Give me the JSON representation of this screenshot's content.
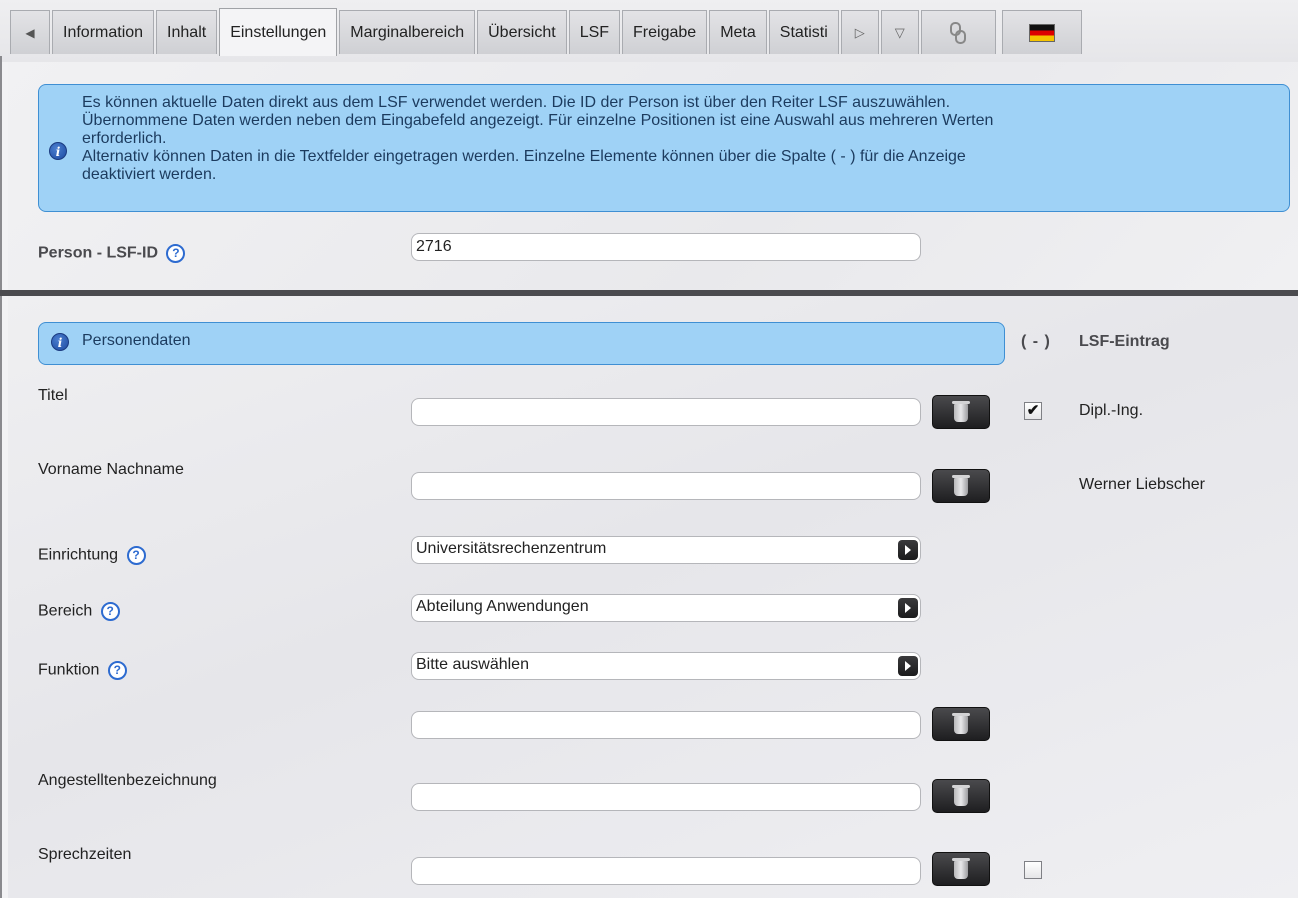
{
  "tabs": {
    "prev_icon": "◀",
    "items": [
      "Information",
      "Inhalt",
      "Einstellungen",
      "Marginalbereich",
      "Übersicht",
      "LSF",
      "Freigabe",
      "Meta",
      "Statisti"
    ],
    "active": "Einstellungen",
    "next_icon": "▷",
    "dropdown_icon": "▽",
    "link_icon": "chain-link-icon",
    "language_flag": "german-flag-icon"
  },
  "info": {
    "line1": "Es können aktuelle Daten direkt aus dem LSF verwendet werden. Die ID der Person ist über den Reiter LSF auszuwählen.",
    "line2": "Übernommene Daten werden neben dem Eingabefeld angezeigt. Für einzelne Positionen ist eine Auswahl aus mehreren Werten",
    "line3": "erforderlich.",
    "line4": "Alternativ können Daten in die Textfelder eingetragen werden. Einzelne Elemente können über die Spalte ( - ) für die Anzeige",
    "line5": "deaktiviert werden."
  },
  "lsf_id": {
    "label": "Person - LSF-ID",
    "value": "2716"
  },
  "section": {
    "title": "Personendaten",
    "toggle_col": "( - )",
    "lsf_col": "LSF-Eintrag"
  },
  "fields": {
    "titel": {
      "label": "Titel",
      "value": "",
      "lsf": "Dipl.-Ing.",
      "checked": true
    },
    "name": {
      "label": "Vorname Nachname",
      "value": "",
      "lsf": "Werner Liebscher"
    },
    "einrichtung": {
      "label": "Einrichtung",
      "value": "Universitätsrechenzentrum"
    },
    "bereich": {
      "label": "Bereich",
      "value": "Abteilung Anwendungen"
    },
    "funktion": {
      "label": "Funktion",
      "value": "Bitte auswählen"
    },
    "funktion_text": {
      "value": ""
    },
    "angestellt": {
      "label": "Angestelltenbezeichnung",
      "value": ""
    },
    "sprechzeiten": {
      "label": "Sprechzeiten",
      "value": "",
      "checked": false
    }
  },
  "help_glyph": "?",
  "info_glyph": "i",
  "check_glyph": "✔"
}
